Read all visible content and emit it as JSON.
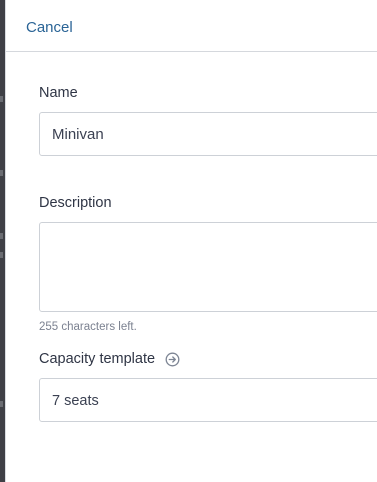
{
  "header": {
    "cancel_label": "Cancel"
  },
  "form": {
    "name": {
      "label": "Name",
      "value": "Minivan"
    },
    "description": {
      "label": "Description",
      "value": "",
      "hint": "255 characters left."
    },
    "capacity_template": {
      "label": "Capacity template",
      "value": "7 seats",
      "info_icon": "arrow-circle-right-icon"
    }
  },
  "colors": {
    "link": "#2a6496",
    "backdrop": "#3f4046",
    "border": "#cdd1d7"
  }
}
